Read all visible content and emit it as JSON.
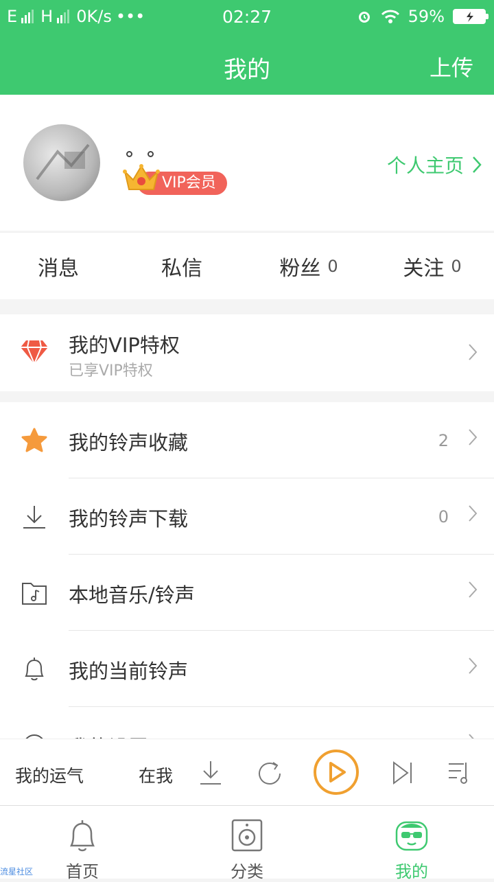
{
  "status_bar": {
    "network_1": "E",
    "network_2": "H",
    "speed": "0K/s",
    "more": "•••",
    "time": "02:27",
    "battery": "59%"
  },
  "header": {
    "title": "我的",
    "upload": "上传"
  },
  "profile": {
    "vip_label": "VIP会员",
    "home_link": "个人主页"
  },
  "stats": [
    {
      "label": "消息",
      "count": ""
    },
    {
      "label": "私信",
      "count": ""
    },
    {
      "label": "粉丝",
      "count": "0"
    },
    {
      "label": "关注",
      "count": "0"
    }
  ],
  "vip_section": {
    "title": "我的VIP特权",
    "subtitle": "已享VIP特权"
  },
  "menu": [
    {
      "label": "我的铃声收藏",
      "count": "2",
      "icon": "star-icon"
    },
    {
      "label": "我的铃声下载",
      "count": "0",
      "icon": "download-icon"
    },
    {
      "label": "本地音乐/铃声",
      "count": "",
      "icon": "music-folder-icon"
    },
    {
      "label": "我的当前铃声",
      "count": "",
      "icon": "bell-icon"
    },
    {
      "label": "我的设置",
      "count": "",
      "icon": "settings-icon"
    }
  ],
  "player": {
    "song": "我的运气",
    "artist": "在我"
  },
  "tabs": [
    {
      "label": "首页",
      "icon": "bell-tab-icon"
    },
    {
      "label": "分类",
      "icon": "speaker-icon"
    },
    {
      "label": "我的",
      "icon": "face-icon"
    }
  ],
  "watermark": "流星社区",
  "colors": {
    "accent": "#3ec970",
    "vip": "#f1635a",
    "play": "#f0a030"
  }
}
